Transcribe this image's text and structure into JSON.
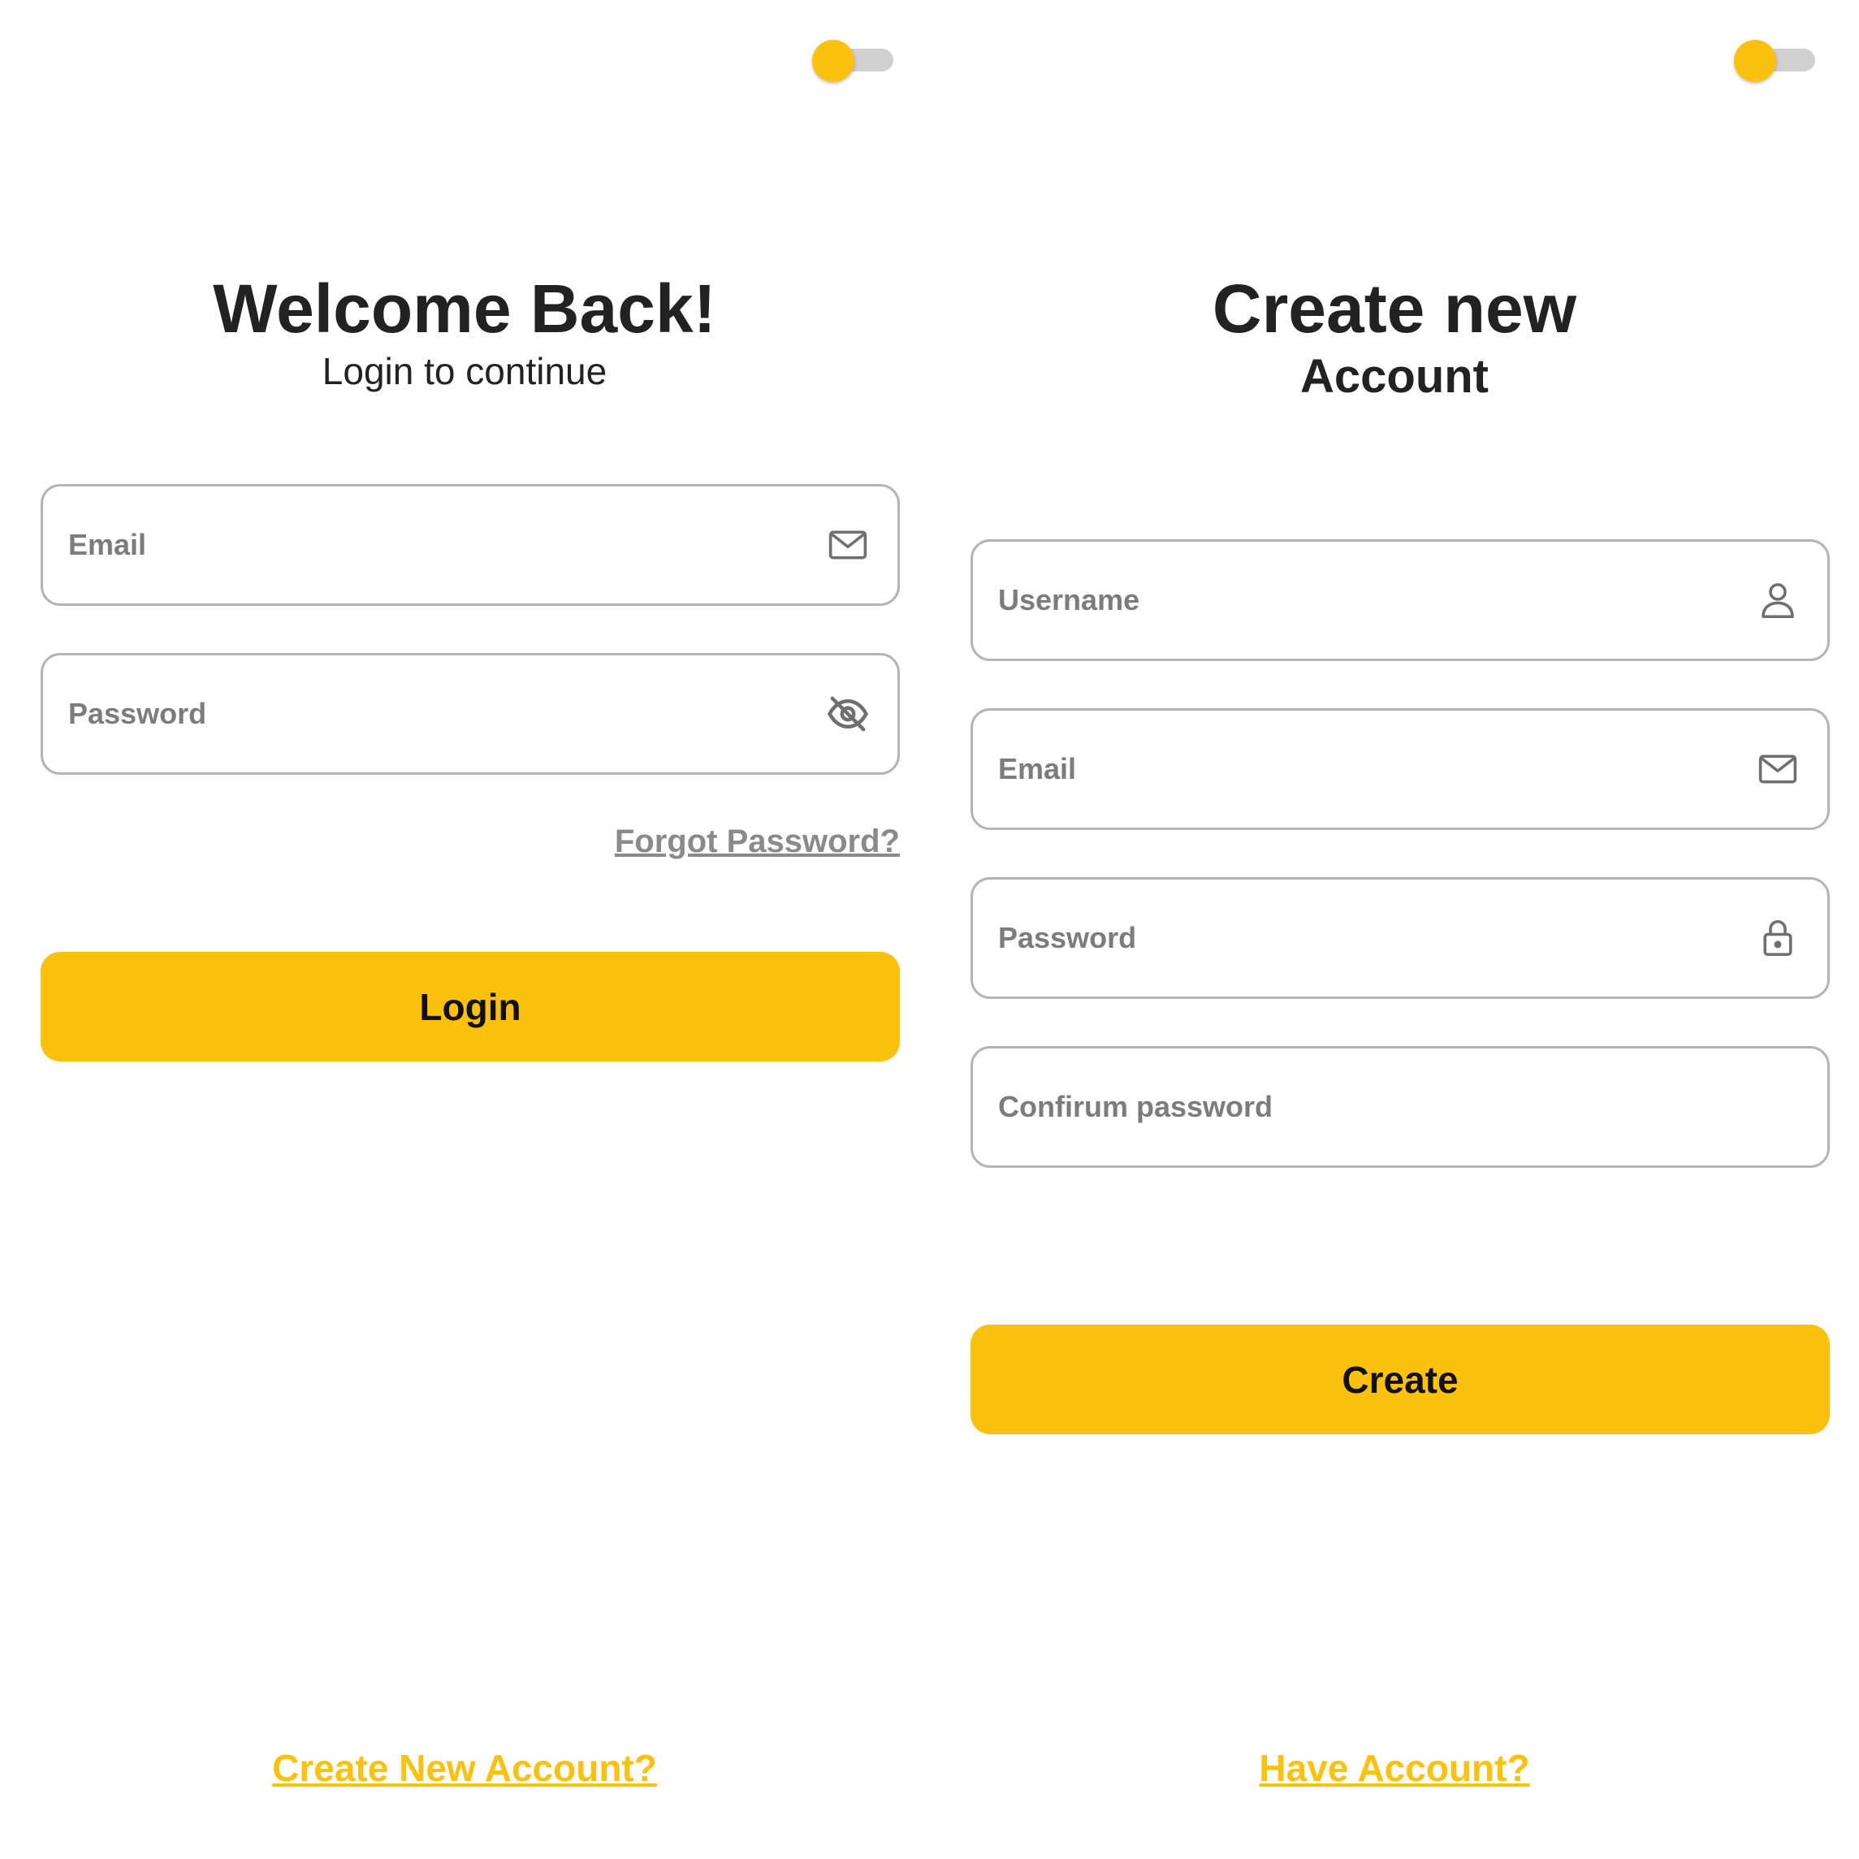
{
  "colors": {
    "accent": "#fcc10c",
    "toggle_track": "#d0d0d0",
    "field_border": "#b4b4b4",
    "placeholder_text": "#7c7c7c",
    "heading_text": "#222222"
  },
  "login": {
    "theme_toggle": {
      "state": "off"
    },
    "title": "Welcome Back!",
    "subtitle": "Login to continue",
    "email": {
      "placeholder": "Email",
      "icon": "mail-icon"
    },
    "password": {
      "placeholder": "Password",
      "icon": "eye-off-icon"
    },
    "forgot_password": "Forgot Password?",
    "login_button": "Login",
    "create_account_link": "Create New Account?"
  },
  "signup": {
    "theme_toggle": {
      "state": "off"
    },
    "title_line1": "Create new",
    "title_line2": "Account",
    "username": {
      "placeholder": "Username",
      "icon": "user-icon"
    },
    "email": {
      "placeholder": "Email",
      "icon": "mail-icon"
    },
    "password": {
      "placeholder": "Password",
      "icon": "lock-icon"
    },
    "confirm_password": {
      "placeholder": "Confirum password"
    },
    "create_button": "Create",
    "have_account_link": "Have Account?"
  }
}
